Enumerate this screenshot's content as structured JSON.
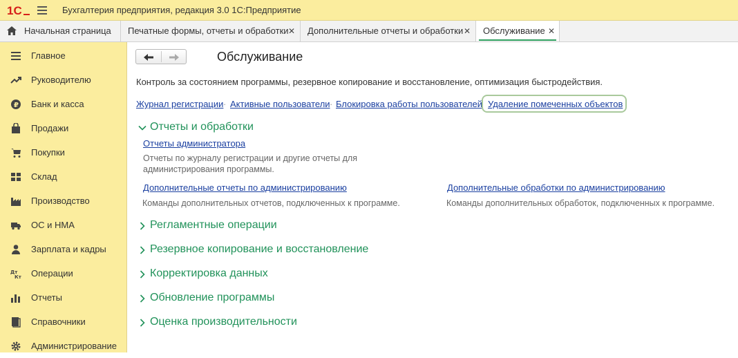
{
  "app": {
    "title": "Бухгалтерия предприятия, редакция 3.0 1С:Предприятие"
  },
  "colors": {
    "accent": "#21925a",
    "link": "#1a3fa0",
    "sidebar_bg": "#fbed9e"
  },
  "tabs": [
    {
      "label": "Начальная страница",
      "icon": "home-icon",
      "closable": false
    },
    {
      "label": "Печатные формы, отчеты и обработки",
      "closable": true
    },
    {
      "label": "Дополнительные отчеты и обработки",
      "closable": true
    },
    {
      "label": "Обслуживание",
      "closable": true,
      "active": true
    }
  ],
  "close_glyph": "✕",
  "sidebar": {
    "items": [
      {
        "label": "Главное",
        "icon": "list-icon"
      },
      {
        "label": "Руководителю",
        "icon": "trend-icon"
      },
      {
        "label": "Банк и касса",
        "icon": "ruble-coin-icon"
      },
      {
        "label": "Продажи",
        "icon": "shopping-bag-icon"
      },
      {
        "label": "Покупки",
        "icon": "shopping-cart-icon"
      },
      {
        "label": "Склад",
        "icon": "warehouse-icon"
      },
      {
        "label": "Производство",
        "icon": "factory-icon"
      },
      {
        "label": "ОС и НМА",
        "icon": "truck-icon"
      },
      {
        "label": "Зарплата и кадры",
        "icon": "person-icon"
      },
      {
        "label": "Операции",
        "icon": "debit-credit-icon"
      },
      {
        "label": "Отчеты",
        "icon": "bar-chart-icon"
      },
      {
        "label": "Справочники",
        "icon": "book-icon"
      },
      {
        "label": "Администрирование",
        "icon": "gear-icon"
      }
    ]
  },
  "main": {
    "title": "Обслуживание",
    "description": "Контроль за состоянием программы, резервное копирование и восстановление, оптимизация быстродействия.",
    "top_links": [
      "Журнал регистрации",
      "Активные пользователи",
      "Блокировка работы пользователей",
      "Удаление помеченных объектов"
    ],
    "groups": [
      {
        "label": "Отчеты и обработки",
        "expanded": true,
        "items": [
          {
            "link": "Отчеты администратора",
            "desc_line1": "Отчеты по журналу регистрации и другие отчеты для",
            "desc_line2": "администрирования программы."
          },
          {
            "link": "Дополнительные отчеты по администрированию",
            "desc_line1": "Команды дополнительных отчетов, подключенных к программе."
          },
          {
            "link": "Дополнительные обработки по администрированию",
            "desc_line1": "Команды дополнительных обработок, подключенных к программе."
          }
        ]
      },
      {
        "label": "Регламентные операции",
        "expanded": false
      },
      {
        "label": "Резервное копирование и восстановление",
        "expanded": false
      },
      {
        "label": "Корректировка данных",
        "expanded": false
      },
      {
        "label": "Обновление программы",
        "expanded": false
      },
      {
        "label": "Оценка производительности",
        "expanded": false
      }
    ]
  }
}
